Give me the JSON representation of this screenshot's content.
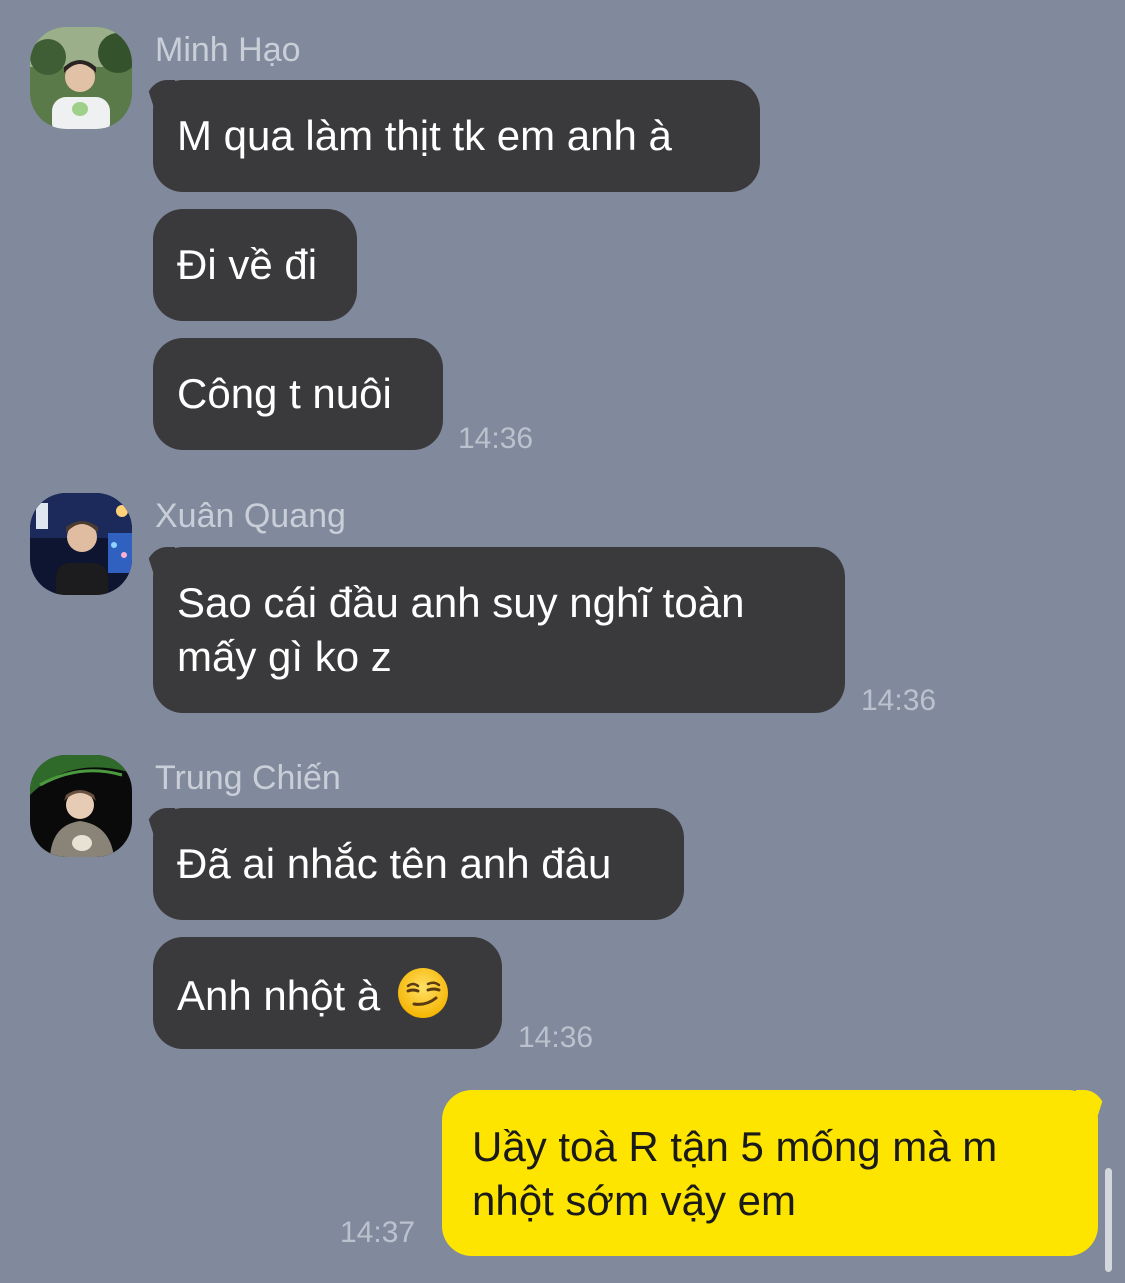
{
  "messages": [
    {
      "sender": "Minh Hạo",
      "avatar": "avatar-minh-hao",
      "bubbles": [
        "M qua làm thịt tk em anh à",
        "Đi về đi",
        "Công t nuôi"
      ],
      "time": "14:36"
    },
    {
      "sender": "Xuân Quang",
      "avatar": "avatar-xuan-quang",
      "bubbles": [
        "Sao cái đầu anh suy nghĩ toàn",
        "mấy gì ko z"
      ],
      "time": "14:36"
    },
    {
      "sender": "Trung Chiến",
      "avatar": "avatar-trung-chien",
      "bubbles": [
        "Đã ai nhắc tên anh đâu",
        "Anh nhột à"
      ],
      "emoji": "smirking-face-emoji",
      "time": "14:36"
    },
    {
      "sender": "me",
      "bubbles": [
        "Uầy toà R tận 5 mống mà m",
        "nhột sớm vậy em"
      ],
      "time": "14:37"
    }
  ],
  "colors": {
    "background": "#808a9c",
    "incoming_bubble": "#3a3a3c",
    "outgoing_bubble": "#fee500",
    "sender_name": "#c9ced8",
    "timestamp": "#bcc2cd"
  }
}
